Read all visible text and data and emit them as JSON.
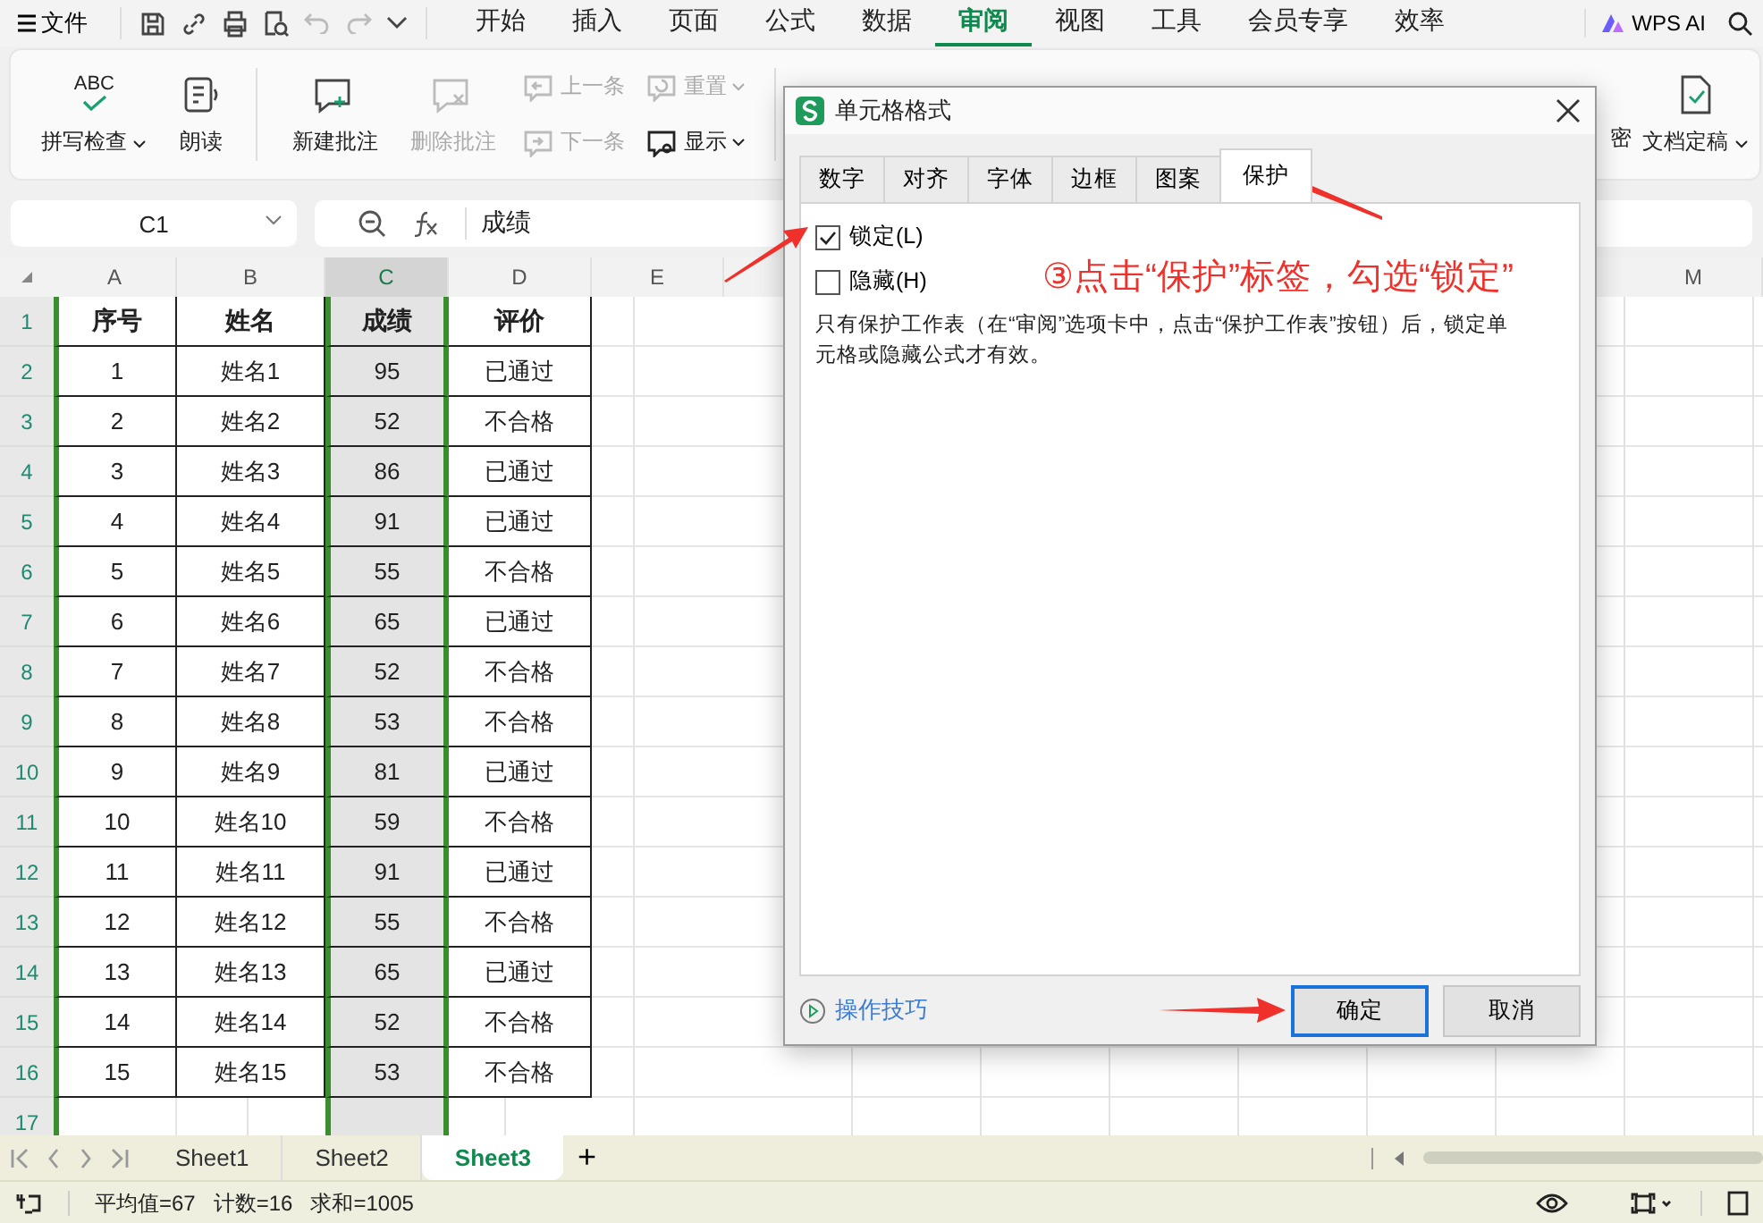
{
  "menu_bar": {
    "file_label": "文件",
    "tabs": [
      {
        "label": "开始",
        "selected": false
      },
      {
        "label": "插入",
        "selected": false
      },
      {
        "label": "页面",
        "selected": false
      },
      {
        "label": "公式",
        "selected": false
      },
      {
        "label": "数据",
        "selected": false
      },
      {
        "label": "审阅",
        "selected": true
      },
      {
        "label": "视图",
        "selected": false
      },
      {
        "label": "工具",
        "selected": false
      },
      {
        "label": "会员专享",
        "selected": false
      },
      {
        "label": "效率",
        "selected": false
      }
    ],
    "ai_label": "WPS AI"
  },
  "ribbon": {
    "left_items": [
      {
        "label": "拼写检查",
        "kind": "large",
        "has_menu": true,
        "disabled": false,
        "icon_text": "ABC"
      },
      {
        "label": "朗读",
        "kind": "large",
        "has_menu": false,
        "disabled": false
      },
      {
        "kind": "divider"
      },
      {
        "label": "新建批注",
        "kind": "large",
        "has_menu": false,
        "disabled": false
      },
      {
        "label": "删除批注",
        "kind": "large",
        "has_menu": false,
        "disabled": true
      },
      {
        "label": "上一条",
        "kind": "small",
        "has_menu": false,
        "disabled": true
      },
      {
        "label": "下一条",
        "kind": "small",
        "has_menu": false,
        "disabled": true
      },
      {
        "label": "重置",
        "kind": "small",
        "has_menu": true,
        "disabled": true
      },
      {
        "label": "显示",
        "kind": "small",
        "has_menu": true,
        "disabled": false
      },
      {
        "kind": "divider"
      }
    ],
    "right_items": [
      {
        "label": "密",
        "kind": "fragment"
      },
      {
        "label": "文档定稿",
        "kind": "large",
        "has_menu": true,
        "disabled": false
      }
    ]
  },
  "formula_bar": {
    "cell_name": "C1",
    "formula": "成绩"
  },
  "grid": {
    "columns": [
      {
        "label": "A",
        "selected": false
      },
      {
        "label": "B",
        "selected": false
      },
      {
        "label": "C",
        "selected": true
      },
      {
        "label": "D",
        "selected": false
      },
      {
        "label": "E",
        "selected": false
      }
    ],
    "far_column": "M",
    "row_numbers": [
      "1",
      "2",
      "3",
      "4",
      "5",
      "6",
      "7",
      "8",
      "9",
      "10",
      "11",
      "12",
      "13",
      "14",
      "15",
      "16",
      "17"
    ],
    "header": [
      "序号",
      "姓名",
      "成绩",
      "评价"
    ],
    "rows": [
      [
        "1",
        "姓名1",
        "95",
        "已通过"
      ],
      [
        "2",
        "姓名2",
        "52",
        "不合格"
      ],
      [
        "3",
        "姓名3",
        "86",
        "已通过"
      ],
      [
        "4",
        "姓名4",
        "91",
        "已通过"
      ],
      [
        "5",
        "姓名5",
        "55",
        "不合格"
      ],
      [
        "6",
        "姓名6",
        "65",
        "已通过"
      ],
      [
        "7",
        "姓名7",
        "52",
        "不合格"
      ],
      [
        "8",
        "姓名8",
        "53",
        "不合格"
      ],
      [
        "9",
        "姓名9",
        "81",
        "已通过"
      ],
      [
        "10",
        "姓名10",
        "59",
        "不合格"
      ],
      [
        "11",
        "姓名11",
        "91",
        "已通过"
      ],
      [
        "12",
        "姓名12",
        "55",
        "不合格"
      ],
      [
        "13",
        "姓名13",
        "65",
        "已通过"
      ],
      [
        "14",
        "姓名14",
        "52",
        "不合格"
      ],
      [
        "15",
        "姓名15",
        "53",
        "不合格"
      ]
    ]
  },
  "sheet_tabs": [
    {
      "label": "Sheet1",
      "selected": false
    },
    {
      "label": "Sheet2",
      "selected": false
    },
    {
      "label": "Sheet3",
      "selected": true
    }
  ],
  "add_sheet": "+",
  "status_bar": {
    "stats": [
      "平均值=67",
      "计数=16",
      "求和=1005"
    ]
  },
  "dialog": {
    "title": "单元格格式",
    "tabs": [
      {
        "label": "数字",
        "selected": false
      },
      {
        "label": "对齐",
        "selected": false
      },
      {
        "label": "字体",
        "selected": false
      },
      {
        "label": "边框",
        "selected": false
      },
      {
        "label": "图案",
        "selected": false
      },
      {
        "label": "保护",
        "selected": true
      }
    ],
    "options": [
      {
        "label": "锁定(L)",
        "checked": true
      },
      {
        "label": "隐藏(H)",
        "checked": false
      }
    ],
    "note": "只有保护工作表（在“审阅”选项卡中，点击“保护工作表”按钮）后，锁定单元格或隐藏公式才有效。",
    "tips_link": "操作技巧",
    "buttons": [
      {
        "label": "确定",
        "kind": "primary"
      },
      {
        "label": "取消",
        "kind": "normal"
      }
    ]
  },
  "annotation": "③点击“保护”标签，勾选“锁定”"
}
